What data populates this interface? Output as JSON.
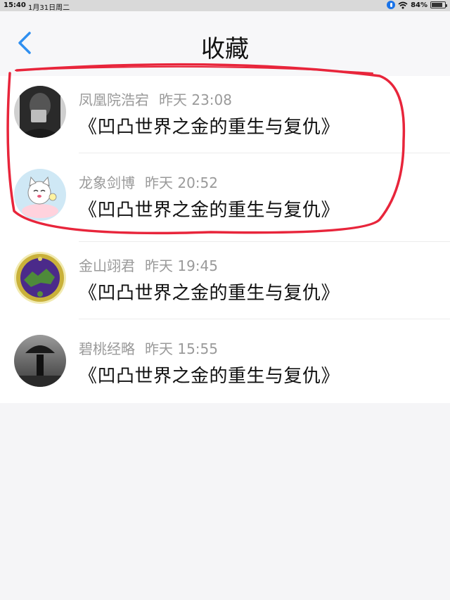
{
  "status_bar": {
    "time": "15:40",
    "date": "1月31日周二",
    "battery_percent": "84%",
    "battery_level": 0.84,
    "accent": "#1a73e8"
  },
  "nav": {
    "title": "收藏",
    "back_icon": "chevron-left-icon",
    "back_color": "#2f8ff0"
  },
  "items": [
    {
      "name": "凤凰院浩宕",
      "time": "昨天 23:08",
      "content": "《凹凸世界之金的重生与复仇》",
      "avatar": "avatar-photo"
    },
    {
      "name": "龙象剑博",
      "time": "昨天 20:52",
      "content": "《凹凸世界之金的重生与复仇》",
      "avatar": "avatar-cat"
    },
    {
      "name": "金山翊君",
      "time": "昨天 19:45",
      "content": "《凹凸世界之金的重生与复仇》",
      "avatar": "avatar-emblem"
    },
    {
      "name": "碧桃经略",
      "time": "昨天 15:55",
      "content": "《凹凸世界之金的重生与复仇》",
      "avatar": "avatar-umbrella"
    }
  ],
  "annotation": {
    "color": "#e8253b"
  }
}
